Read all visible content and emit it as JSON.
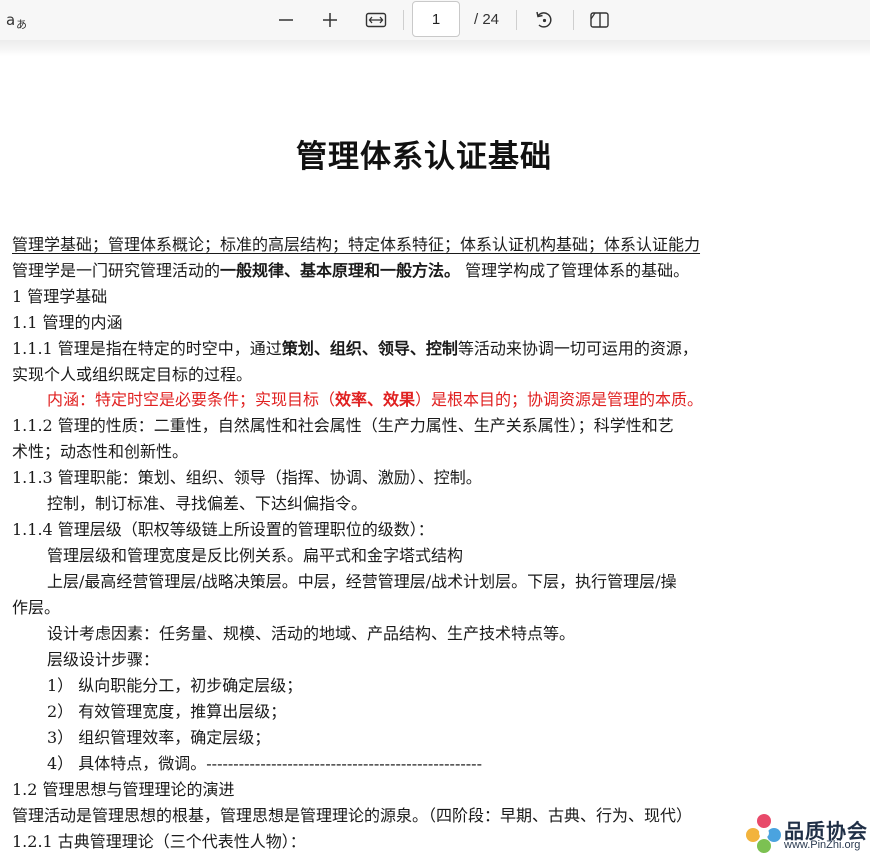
{
  "toolbar": {
    "page_current": "1",
    "page_total": "/ 24",
    "icons": [
      "read-aloud-icon",
      "zoom-out-icon",
      "zoom-in-icon",
      "fit-page-icon",
      "rotate-icon",
      "page-view-icon"
    ]
  },
  "document": {
    "title": "管理体系认证基础",
    "keywords": "管理学基础；管理体系概论；标准的高层结构；特定体系特征；体系认证机构基础；体系认证能力",
    "intro": {
      "a": "管理学是一门研究管理活动的",
      "b": "一般规律、基本原理和一般方法。",
      "c": " 管理学构成了管理体系的基础。"
    },
    "h1": "1 管理学基础",
    "h1_1": "1.1 管理的内涵",
    "p111": {
      "a": "1.1.1 管理是指在特定的时空中，通过",
      "b": "策划、组织、领导、控制",
      "c": "等活动来协调一切可运用的资源，"
    },
    "p111_cont": "实现个人或组织既定目标的过程。",
    "p111_note": {
      "a": "内涵：特定时空是必要条件；实现目标（",
      "b": "效率、效果",
      "c": "）是根本目的；协调资源是管理的本质。"
    },
    "p112": "1.1.2 管理的性质：二重性，自然属性和社会属性（生产力属性、生产关系属性）；科学性和艺",
    "p112_cont": "术性；动态性和创新性。",
    "p113": "1.1.3 管理职能：策划、组织、领导（指挥、协调、激励）、控制。",
    "p113_sub": "控制，制订标准、寻找偏差、下达纠偏指令。",
    "p114": "1.1.4 管理层级（职权等级链上所设置的管理职位的级数）：",
    "p114_a": "管理层级和管理宽度是反比例关系。扁平式和金字塔式结构",
    "p114_b": "上层/最高经营管理层/战略决策层。中层，经营管理层/战术计划层。下层，执行管理层/操",
    "p114_b_cont": "作层。",
    "p114_c": "设计考虑因素：任务量、规模、活动的地域、产品结构、生产技术特点等。",
    "p114_d": "层级设计步骤：",
    "steps": [
      "1）  纵向职能分工，初步确定层级；",
      "2）  有效管理宽度，推算出层级；",
      "3）  组织管理效率，确定层级；",
      "4）  具体特点，微调。---------------------------------------------------"
    ],
    "h1_2": "1.2 管理思想与管理理论的演进",
    "p12": "管理活动是管理思想的根基，管理思想是管理理论的源泉。（四阶段：早期、古典、行为、现代）",
    "p121": "1.2.1 古典管理理论（三个代表性人物）："
  },
  "watermark": {
    "name": "品质协会",
    "url": "www.PinZhi.org"
  },
  "colors": {
    "highlight_red": "#e02020",
    "toolbar_bg": "#f7f7f7"
  }
}
